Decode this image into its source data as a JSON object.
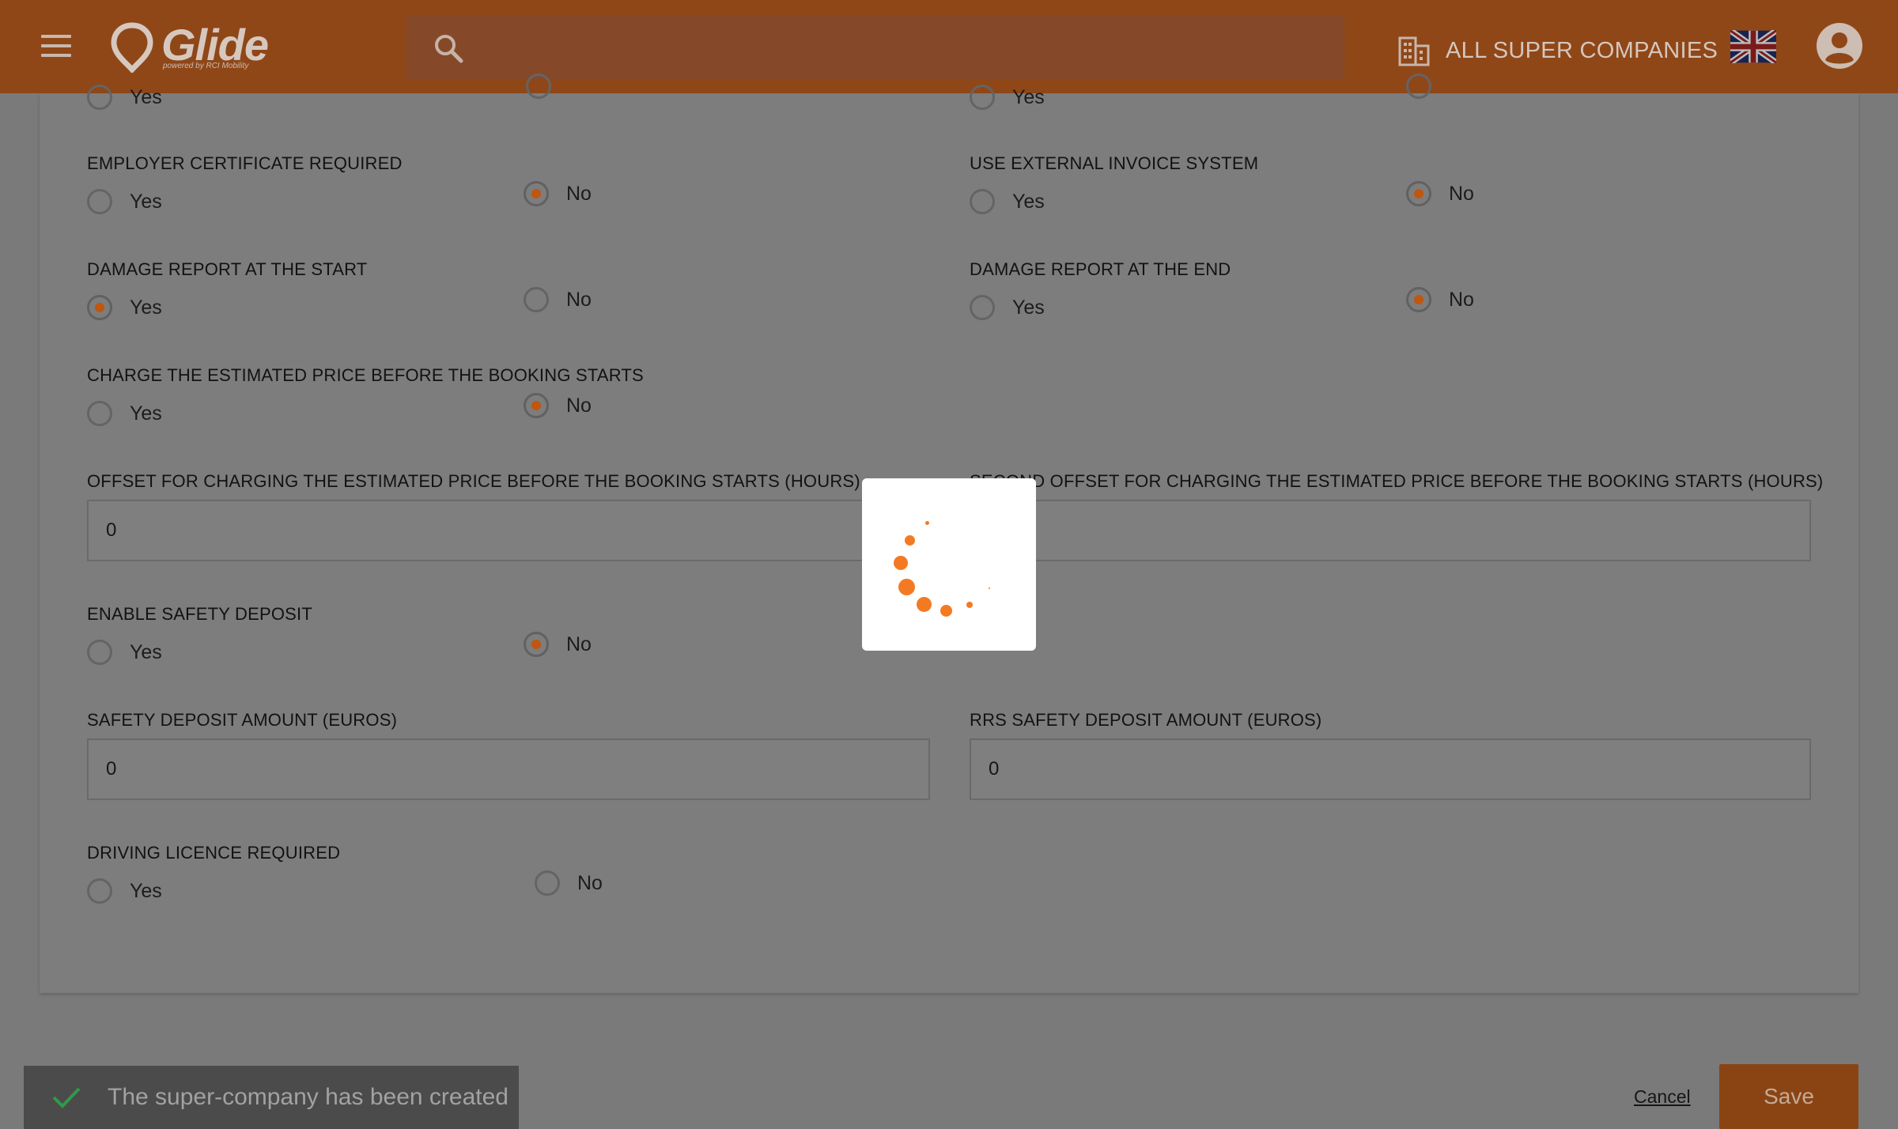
{
  "header": {
    "logo_text": "Glide",
    "logo_subtext": "powered by RCI Mobility",
    "search_placeholder": "",
    "company_label": "ALL SUPER COMPANIES"
  },
  "form": {
    "radio_groups": [
      {
        "label": "EMPLOYER CERTIFICATE REQUIRED",
        "yes": "Yes",
        "no": "No",
        "selected": "No"
      },
      {
        "label": "USE EXTERNAL INVOICE SYSTEM",
        "yes": "Yes",
        "no": "No",
        "selected": "No"
      },
      {
        "label": "DAMAGE REPORT AT THE START",
        "yes": "Yes",
        "no": "No",
        "selected": "Yes"
      },
      {
        "label": "DAMAGE REPORT AT THE END",
        "yes": "Yes",
        "no": "No",
        "selected": "No"
      },
      {
        "label": "CHARGE THE ESTIMATED PRICE BEFORE THE BOOKING STARTS",
        "yes": "Yes",
        "no": "No",
        "selected": "No"
      },
      {
        "label": "ENABLE SAFETY DEPOSIT",
        "yes": "Yes",
        "no": "No",
        "selected": "No"
      },
      {
        "label": "DRIVING LICENCE REQUIRED",
        "yes": "Yes",
        "no": "No",
        "selected": ""
      }
    ],
    "top_partial": {
      "yes": "Yes"
    },
    "text_fields": [
      {
        "label": "OFFSET FOR CHARGING THE ESTIMATED PRICE BEFORE THE BOOKING STARTS (HOURS)",
        "value": "0"
      },
      {
        "label": "SECOND OFFSET FOR CHARGING THE ESTIMATED PRICE BEFORE THE BOOKING STARTS (HOURS)",
        "value": ""
      },
      {
        "label": "SAFETY DEPOSIT AMOUNT (EUROS)",
        "value": "0"
      },
      {
        "label": "RRS SAFETY DEPOSIT AMOUNT (EUROS)",
        "value": "0"
      }
    ]
  },
  "footer": {
    "toast_message": "The super-company has been created",
    "cancel_label": "Cancel",
    "save_label": "Save"
  },
  "colors": {
    "header_bg": "#8f4718",
    "accent": "#c0560f",
    "spinner": "#f37a22",
    "overlay_bg": "#7a7a7a"
  }
}
